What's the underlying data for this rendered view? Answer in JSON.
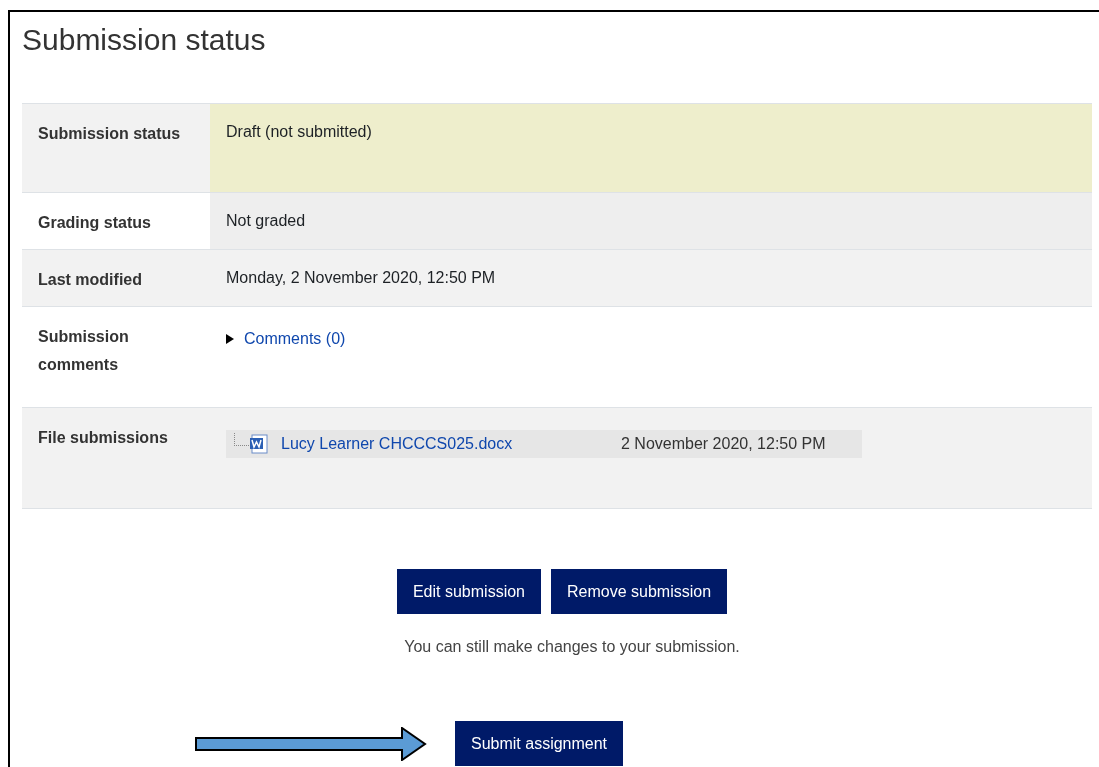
{
  "title": "Submission status",
  "rows": [
    {
      "kind": "text",
      "label": "Submission status",
      "value": "Draft (not submitted)",
      "color": "#eeeecc"
    },
    {
      "kind": "text",
      "label": "Grading status",
      "value": "Not graded",
      "color": "#eeeeee"
    },
    {
      "kind": "text",
      "label": "Last modified",
      "value": "Monday, 2 November 2020, 12:50 PM"
    },
    {
      "kind": "comments",
      "label": "Submission comments",
      "toggle": "Comments (0)",
      "expanded": false
    },
    {
      "kind": "files",
      "label": "File submissions",
      "files": [
        {
          "name": "Lucy Learner CHCCCS025.docx",
          "date": "2 November 2020, 12:50 PM"
        }
      ]
    }
  ],
  "actions": [
    "Edit submission",
    "Remove submission"
  ],
  "note": "You can still make changes to your submission.",
  "submit": "Submit assignment"
}
